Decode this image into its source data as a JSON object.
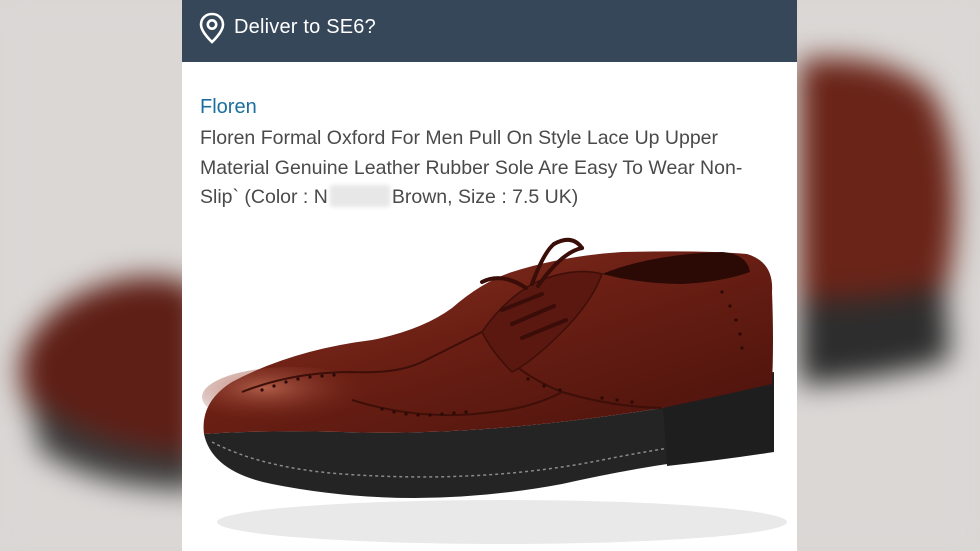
{
  "header": {
    "deliver_label": "Deliver to SE6?",
    "icon": "location-pin-icon"
  },
  "product": {
    "brand": "Floren",
    "title_part1": "Floren Formal Oxford For Men Pull On Style Lace Up Upper Material Genuine Leather Rubber Sole Are Easy To Wear Non-Slip` (Color : N",
    "title_part2": "Brown, Size : 7.5 UK)",
    "image_subject": "brown-brogue-oxford-shoe"
  },
  "colors": {
    "header_bg": "#37475a",
    "brand_link": "#1b6f9f",
    "title_text": "#4a4a4a",
    "leather": "#6b1f14"
  }
}
